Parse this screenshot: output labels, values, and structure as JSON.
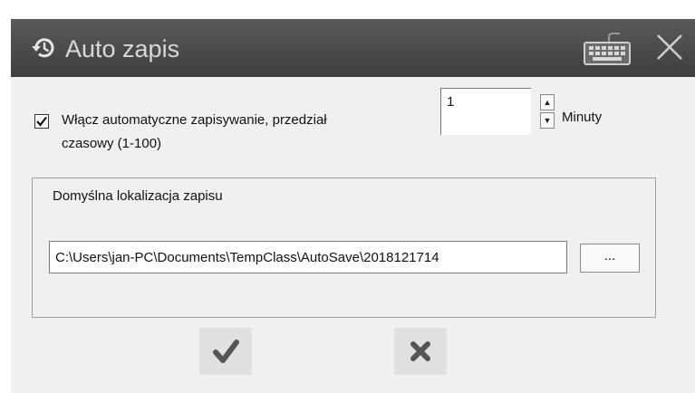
{
  "window": {
    "title": "Auto zapis",
    "title_icon": "history-icon",
    "keyboard_icon": "keyboard-icon",
    "close_icon": "close-icon"
  },
  "autosave": {
    "checkbox_checked": true,
    "checkbox_label_line1": "Włącz automatyczne zapisywanie, przedział",
    "checkbox_label_line2": "czasowy (1-100)",
    "interval_value": "1",
    "spin_up_glyph": "▲",
    "spin_down_glyph": "▼",
    "unit_label": "Minuty"
  },
  "location": {
    "group_title": "Domyślna lokalizacja zapisu",
    "path_value": "C:\\Users\\jan-PC\\Documents\\TempClass\\AutoSave\\2018121714",
    "browse_label": "..."
  },
  "actions": {
    "ok_icon": "checkmark-icon",
    "cancel_icon": "x-mark-icon"
  },
  "colors": {
    "titlebar": "#464646",
    "title_text": "#d8d8d8",
    "dialog_bg": "#f0f0f0",
    "action_icon": "#555555"
  }
}
